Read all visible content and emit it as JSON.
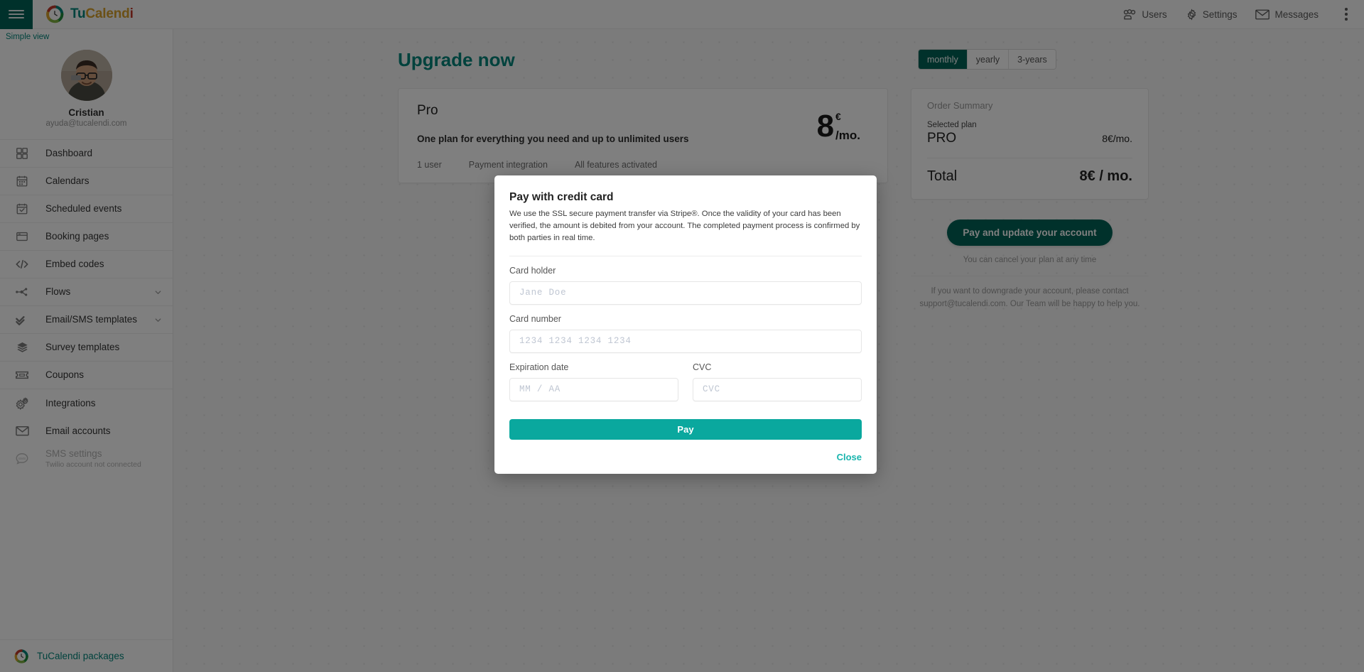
{
  "topbar": {
    "menu_icon": "hamburger-menu-icon",
    "brand": {
      "part1": "Tu",
      "part2": "Calend",
      "part3": "i",
      "logo_icon": "tucalendi-logo-icon"
    },
    "items": [
      {
        "label": "Users",
        "icon": "users-icon"
      },
      {
        "label": "Settings",
        "icon": "gear-icon"
      },
      {
        "label": "Messages",
        "icon": "envelope-icon"
      }
    ],
    "overflow_icon": "kebab-menu-icon"
  },
  "sidebar": {
    "simple_view": "Simple view",
    "profile": {
      "name": "Cristian",
      "email": "ayuda@tucalendi.com",
      "avatar_icon": "user-avatar-photo"
    },
    "items": [
      {
        "label": "Dashboard",
        "icon": "grid-icon",
        "chevron": false,
        "disabled": false,
        "sub": ""
      },
      {
        "label": "Calendars",
        "icon": "calendar-icon",
        "chevron": false,
        "disabled": false,
        "sub": ""
      },
      {
        "label": "Scheduled events",
        "icon": "calendar-check-icon",
        "chevron": false,
        "disabled": false,
        "sub": ""
      },
      {
        "label": "Booking pages",
        "icon": "window-icon",
        "chevron": false,
        "disabled": false,
        "sub": ""
      },
      {
        "label": "Embed codes",
        "icon": "code-icon",
        "chevron": false,
        "disabled": false,
        "sub": ""
      },
      {
        "label": "Flows",
        "icon": "flow-nodes-icon",
        "chevron": true,
        "disabled": false,
        "sub": ""
      },
      {
        "label": "Email/SMS templates",
        "icon": "double-check-icon",
        "chevron": true,
        "disabled": false,
        "sub": ""
      },
      {
        "label": "Survey templates",
        "icon": "layers-icon",
        "chevron": false,
        "disabled": false,
        "sub": ""
      },
      {
        "label": "Coupons",
        "icon": "ticket-icon",
        "chevron": false,
        "disabled": false,
        "sub": ""
      },
      {
        "label": "Integrations",
        "icon": "gears-icon",
        "chevron": false,
        "disabled": false,
        "sub": ""
      },
      {
        "label": "Email accounts",
        "icon": "envelope-icon",
        "chevron": false,
        "disabled": false,
        "sub": ""
      },
      {
        "label": "SMS settings",
        "icon": "sms-bubble-icon",
        "chevron": false,
        "disabled": true,
        "sub": "Twilio account not connected"
      }
    ],
    "footer": {
      "label": "TuCalendi packages",
      "icon": "tucalendi-logo-icon"
    }
  },
  "main": {
    "title": "Upgrade now",
    "periods": [
      {
        "label": "monthly",
        "active": true
      },
      {
        "label": "yearly",
        "active": false
      },
      {
        "label": "3-years",
        "active": false
      }
    ],
    "plan": {
      "name": "Pro",
      "description": "One plan for everything you need and up to unlimited users",
      "features": [
        "1 user",
        "Payment integration",
        "All features activated"
      ],
      "price_number": "8",
      "price_currency": "€",
      "price_period": "/mo."
    },
    "summary": {
      "title": "Order Summary",
      "selected_plan_label": "Selected plan",
      "plan_name": "PRO",
      "plan_price": "8€/mo.",
      "total_label": "Total",
      "total_value": "8€ / mo.",
      "pay_button": "Pay and update your account",
      "cancel_note": "You can cancel your plan at any time",
      "downgrade_note": "If you want to downgrade your account, please contact support@tucalendi.com. Our Team will be happy to help you."
    }
  },
  "modal": {
    "title": "Pay with credit card",
    "description": "We use the SSL secure payment transfer via Stripe®. Once the validity of your card has been verified, the amount is debited from your account. The completed payment process is confirmed by both parties in real time.",
    "fields": {
      "card_holder": {
        "label": "Card holder",
        "placeholder": "Jane Doe",
        "value": ""
      },
      "card_number": {
        "label": "Card number",
        "placeholder": "1234 1234 1234 1234",
        "value": ""
      },
      "expiration": {
        "label": "Expiration date",
        "placeholder": "MM / AA",
        "value": ""
      },
      "cvc": {
        "label": "CVC",
        "placeholder": "CVC",
        "value": ""
      }
    },
    "pay_button": "Pay",
    "close_link": "Close"
  },
  "colors": {
    "brand_dark_teal": "#006257",
    "brand_teal": "#00857a",
    "pay_teal": "#0aa89e",
    "close_teal": "#19b5ae",
    "brand_gold": "#d7a12c",
    "brand_red": "#c0392b"
  }
}
